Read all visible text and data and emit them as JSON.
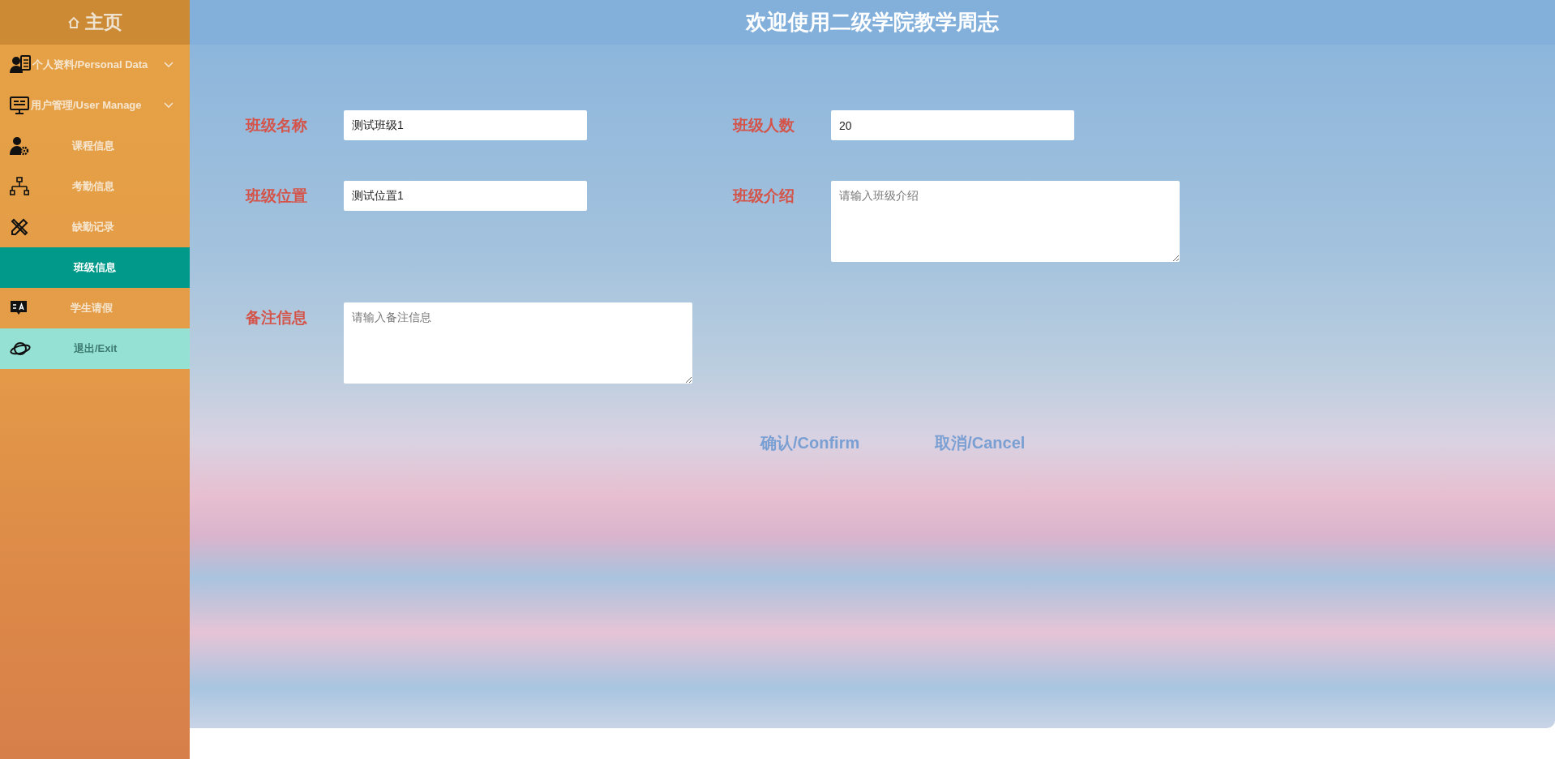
{
  "sidebar": {
    "home": {
      "label": "主页"
    },
    "items": [
      {
        "label": "个人资料/Personal Data",
        "kind": "group",
        "selected": false
      },
      {
        "label": "用户管理/User Manage",
        "kind": "group",
        "selected": false
      },
      {
        "label": "课程信息",
        "kind": "link",
        "selected": false
      },
      {
        "label": "考勤信息",
        "kind": "link",
        "selected": false
      },
      {
        "label": "缺勤记录",
        "kind": "link",
        "selected": false
      },
      {
        "label": "班级信息",
        "kind": "link",
        "selected": true
      },
      {
        "label": "学生请假",
        "kind": "link",
        "selected": false
      },
      {
        "label": "退出/Exit",
        "kind": "exit",
        "selected": false
      }
    ]
  },
  "header": {
    "title": "欢迎使用二级学院教学周志"
  },
  "form": {
    "rows": [
      [
        {
          "label": "班级名称",
          "kind": "input",
          "value": "测试班级1"
        },
        {
          "label": "班级人数",
          "kind": "input",
          "value": "20"
        }
      ],
      [
        {
          "label": "班级位置",
          "kind": "input",
          "value": "测试位置1"
        },
        {
          "label": "班级介绍",
          "kind": "textarea",
          "placeholder": "请输入班级介绍"
        }
      ],
      [
        {
          "label": "备注信息",
          "kind": "textarea",
          "placeholder": "请输入备注信息"
        }
      ]
    ],
    "buttons": [
      {
        "label": "确认/Confirm"
      },
      {
        "label": "取消/Cancel"
      }
    ]
  }
}
